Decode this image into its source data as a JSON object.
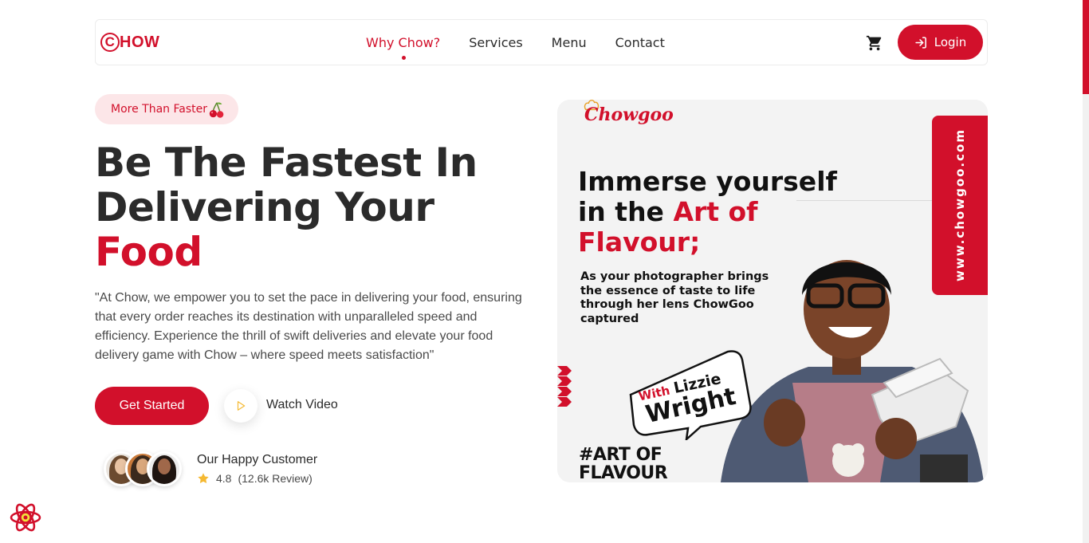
{
  "brand": {
    "logo_text": "CHOW"
  },
  "nav": {
    "items": [
      {
        "label": "Why Chow?",
        "active": true
      },
      {
        "label": "Services",
        "active": false
      },
      {
        "label": "Menu",
        "active": false
      },
      {
        "label": "Contact",
        "active": false
      }
    ],
    "cart_icon": "cart-icon",
    "login_label": "Login",
    "login_icon": "sign-in-icon"
  },
  "hero": {
    "tag": "More Than Faster",
    "tag_icon": "cherry-icon",
    "title_line1": "Be The Fastest In",
    "title_line2": "Delivering Your",
    "title_accent": "Food",
    "description": "\"At Chow, we empower you to set the pace in delivering your food, ensuring that every order reaches its destination with unparalleled speed and efficiency. Experience the thrill of swift deliveries and elevate your food delivery game with Chow – where speed meets satisfaction\"",
    "cta_primary": "Get Started",
    "cta_secondary": "Watch Video",
    "customers": {
      "label": "Our Happy Customer",
      "rating": "4.8",
      "reviews": "(12.6k Review)"
    }
  },
  "promo": {
    "brand": "Chowgoo",
    "headline_1": "Immerse yourself",
    "headline_2": "in the ",
    "headline_red_1": "Art of",
    "headline_red_2": "Flavour;",
    "subtext": "As your photographer brings the essence of taste to life through her lens ChowGoo captured",
    "side_url": "www.chowgoo.com",
    "bubble_with": "With",
    "bubble_name_1": "Lizzie",
    "bubble_name_2": "Wright",
    "hashtag_1": "#ART OF",
    "hashtag_2": "FLAVOUR"
  },
  "colors": {
    "accent": "#d2102b",
    "accent_soft": "#fce6e8",
    "text": "#2b2b2b",
    "star": "#f5b932"
  }
}
